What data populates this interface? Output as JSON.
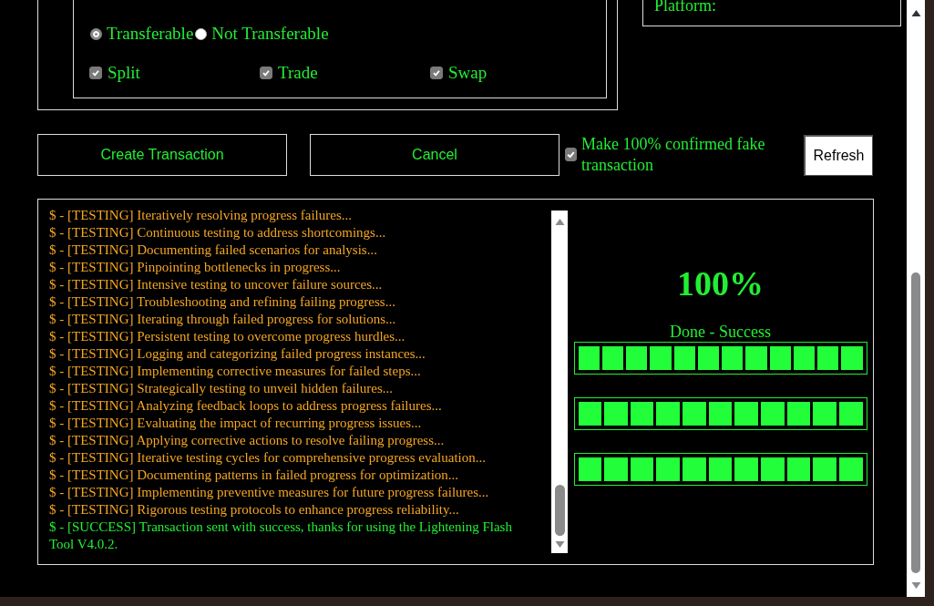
{
  "options_panel": {
    "transfer": [
      {
        "label": "Transferable",
        "selected": true
      },
      {
        "label": "Not Transferable",
        "selected": false
      }
    ],
    "features": [
      {
        "label": "Split",
        "checked": true
      },
      {
        "label": "Trade",
        "checked": true
      },
      {
        "label": "Swap",
        "checked": true
      }
    ]
  },
  "platform_panel": {
    "label": "Platform:"
  },
  "actions": {
    "create": "Create Transaction",
    "cancel": "Cancel",
    "fake_confirm": {
      "label": "Make 100% confirmed fake transaction",
      "checked": true
    },
    "refresh": "Refresh"
  },
  "log": [
    {
      "kind": "testing",
      "text": "$ - [TESTING] Iteratively resolving progress failures..."
    },
    {
      "kind": "testing",
      "text": "$ - [TESTING] Continuous testing to address shortcomings..."
    },
    {
      "kind": "testing",
      "text": "$ - [TESTING] Documenting failed scenarios for analysis..."
    },
    {
      "kind": "testing",
      "text": "$ - [TESTING] Pinpointing bottlenecks in progress..."
    },
    {
      "kind": "testing",
      "text": "$ - [TESTING] Intensive testing to uncover failure sources..."
    },
    {
      "kind": "testing",
      "text": "$ - [TESTING] Troubleshooting and refining failing progress..."
    },
    {
      "kind": "testing",
      "text": "$ - [TESTING] Iterating through failed progress for solutions..."
    },
    {
      "kind": "testing",
      "text": "$ - [TESTING] Persistent testing to overcome progress hurdles..."
    },
    {
      "kind": "testing",
      "text": "$ - [TESTING] Logging and categorizing failed progress instances..."
    },
    {
      "kind": "testing",
      "text": "$ - [TESTING] Implementing corrective measures for failed steps..."
    },
    {
      "kind": "testing",
      "text": "$ - [TESTING] Strategically testing to unveil hidden failures..."
    },
    {
      "kind": "testing",
      "text": "$ - [TESTING] Analyzing feedback loops to address progress failures..."
    },
    {
      "kind": "testing",
      "text": "$ - [TESTING] Evaluating the impact of recurring progress issues..."
    },
    {
      "kind": "testing",
      "text": "$ - [TESTING] Applying corrective actions to resolve failing progress..."
    },
    {
      "kind": "testing",
      "text": "$ - [TESTING] Iterative testing cycles for comprehensive progress evaluation..."
    },
    {
      "kind": "testing",
      "text": "$ - [TESTING] Documenting patterns in failed progress for optimization..."
    },
    {
      "kind": "testing",
      "text": "$ - [TESTING] Implementing preventive measures for future progress failures..."
    },
    {
      "kind": "testing",
      "text": "$ - [TESTING] Rigorous testing protocols to enhance progress reliability..."
    },
    {
      "kind": "success",
      "text": "$ - [SUCCESS] Transaction sent with success, thanks for using the Lightening Flash Tool V4.0.2."
    }
  ],
  "progress": {
    "percent": "100%",
    "status": "Done - Success",
    "bars": [
      {
        "level": 1
      },
      {
        "level": 1
      },
      {
        "level": 1
      }
    ]
  }
}
